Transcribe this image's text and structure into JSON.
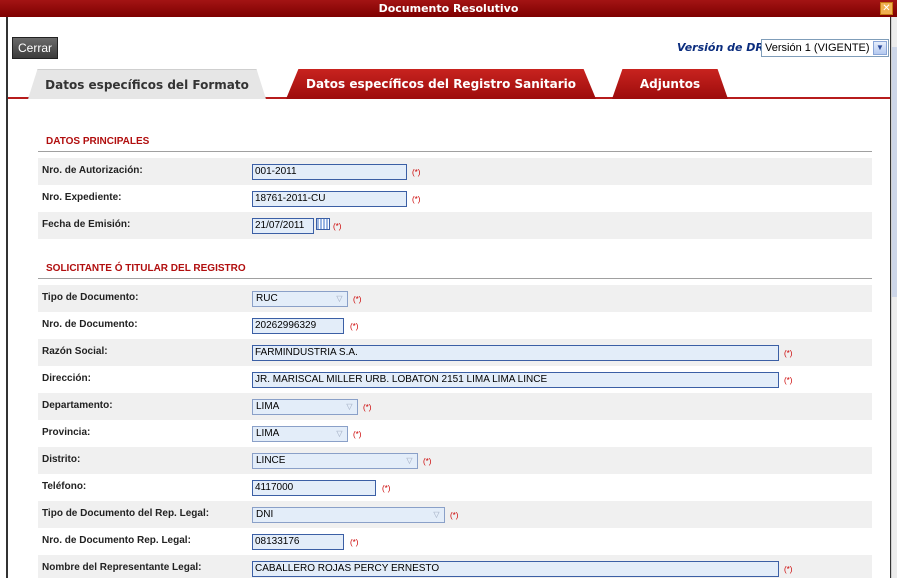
{
  "window": {
    "title": "Documento Resolutivo",
    "close_glyph": "✕"
  },
  "toolbar": {
    "close_label": "Cerrar",
    "version_label": "Versión de DR:",
    "version_value": "Versión 1 (VIGENTE)",
    "dropdown_glyph": "▼"
  },
  "tabs": [
    {
      "label": "Datos específicos del Formato",
      "active": true
    },
    {
      "label": "Datos específicos del Registro Sanitario",
      "active": false
    },
    {
      "label": "Adjuntos",
      "active": false
    }
  ],
  "required_marker": "(*)",
  "select_arrow": "▽",
  "datos_principales": {
    "title": "DATOS PRINCIPALES",
    "nro_autorizacion": {
      "label": "Nro. de Autorización:",
      "value": "001-2011"
    },
    "nro_expediente": {
      "label": "Nro. Expediente:",
      "value": "18761-2011-CU"
    },
    "fecha_emision": {
      "label": "Fecha de Emisión:",
      "value": "21/07/2011"
    }
  },
  "solicitante": {
    "title": "SOLICITANTE Ó TITULAR DEL REGISTRO",
    "tipo_documento": {
      "label": "Tipo de Documento:",
      "value": "RUC"
    },
    "nro_documento": {
      "label": "Nro. de Documento:",
      "value": "20262996329"
    },
    "razon_social": {
      "label": "Razón Social:",
      "value": "FARMINDUSTRIA S.A."
    },
    "direccion": {
      "label": "Dirección:",
      "value": "JR. MARISCAL MILLER URB. LOBATON 2151 LIMA LIMA LINCE"
    },
    "departamento": {
      "label": "Departamento:",
      "value": "LIMA"
    },
    "provincia": {
      "label": "Provincia:",
      "value": "LIMA"
    },
    "distrito": {
      "label": "Distrito:",
      "value": "LINCE"
    },
    "telefono": {
      "label": "Teléfono:",
      "value": "4117000"
    },
    "tipo_doc_rep": {
      "label": "Tipo de Documento del Rep. Legal:",
      "value": "DNI"
    },
    "nro_doc_rep": {
      "label": "Nro. de Documento Rep. Legal:",
      "value": "08133176"
    },
    "nombre_rep": {
      "label": "Nombre del Representante Legal:",
      "value": "CABALLERO ROJAS PERCY ERNESTO"
    }
  }
}
